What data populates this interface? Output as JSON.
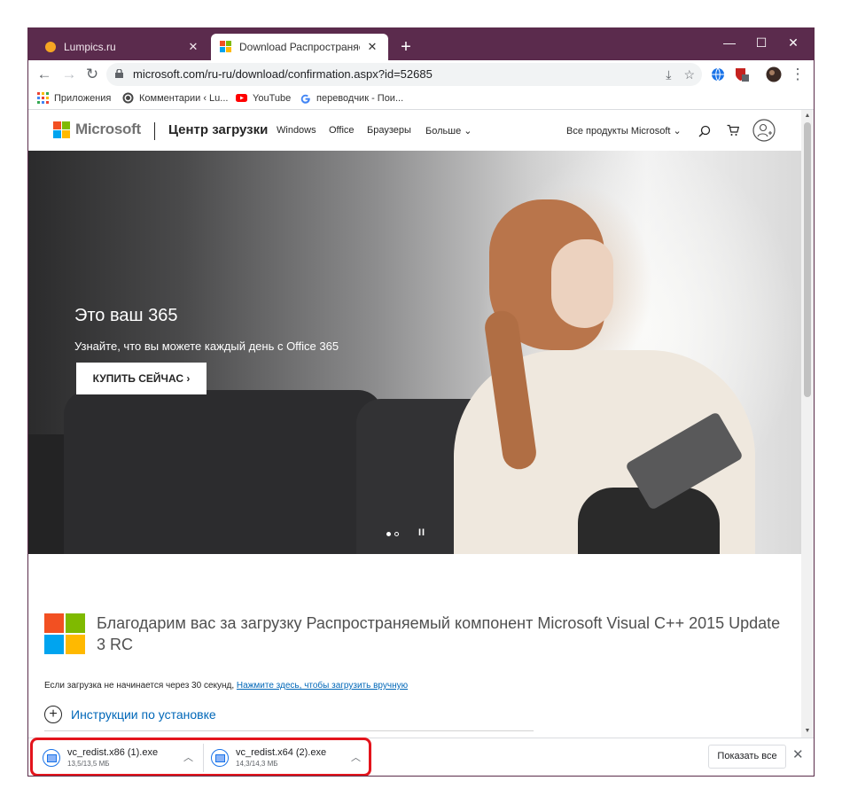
{
  "tabs": [
    {
      "title": "Lumpics.ru",
      "favicon_color": "#f5a623"
    },
    {
      "title": "Download Распространяемый к",
      "favicon": "microsoft-logo"
    }
  ],
  "window_controls": {
    "minimize": "—",
    "maximize": "☐",
    "close": "✕"
  },
  "toolbar": {
    "url": "microsoft.com/ru-ru/download/confirmation.aspx?id=52685"
  },
  "bookmarks": [
    "Приложения",
    "Комментарии ‹ Lu...",
    "YouTube",
    "переводчик - Пои..."
  ],
  "site_header": {
    "brand": "Microsoft",
    "section": "Центр загрузки",
    "nav": [
      "Windows",
      "Office",
      "Браузеры",
      "Больше"
    ],
    "all_products": "Все продукты Microsoft"
  },
  "hero": {
    "title": "Это ваш 365",
    "subtitle": "Узнайте, что вы можете каждый день с Office 365",
    "button": "КУПИТЬ СЕЙЧАС",
    "pause_glyph": "II"
  },
  "thanks": {
    "text": "Благодарим вас за загрузку Распространяемый компонент Microsoft Visual C++ 2015 Update 3 RC",
    "retry_prefix": "Если загрузка не начинается через 30 секунд,",
    "retry_link": "Нажмите здесь, чтобы загрузить вручную",
    "instructions": "Инструкции по установке"
  },
  "downloads": [
    {
      "name": "vc_redist.x86 (1).exe",
      "size": "13,5/13,5 МБ"
    },
    {
      "name": "vc_redist.x64 (2).exe",
      "size": "14,3/14,3 МБ"
    }
  ],
  "shelf": {
    "show_all": "Показать все"
  },
  "colors": {
    "tabstrip": "#5b2b4d",
    "ms_red": "#f25022",
    "ms_green": "#7fba00",
    "ms_blue": "#00a4ef",
    "ms_yellow": "#ffb900",
    "link": "#0067b8",
    "highlight": "#e3141c"
  }
}
